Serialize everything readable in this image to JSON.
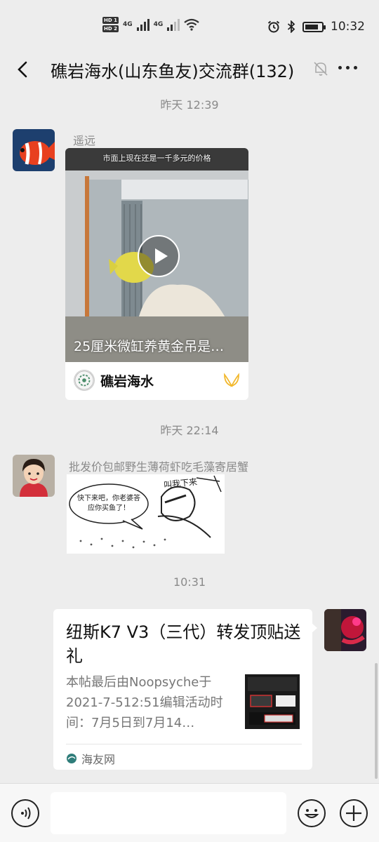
{
  "status_bar": {
    "hd1": "HD 1",
    "hd2": "HD 2",
    "net1": "4G",
    "net2": "4G",
    "time": "10:32",
    "icons": [
      "alarm-icon",
      "bluetooth-icon",
      "battery-icon",
      "wifi-icon"
    ],
    "battery_level": 0.8
  },
  "header": {
    "title": "礁岩海水(山东鱼友)交流群(132)"
  },
  "messages": [
    {
      "timestamp": "昨天 12:39",
      "sender": "遥远",
      "video": {
        "caption": "市面上现在还是一千多元的价格",
        "title": "25厘米微缸养黄金吊是…",
        "channel": "礁岩海水"
      }
    },
    {
      "timestamp": "昨天 22:14",
      "sender": "批发价包邮野生薄荷虾吃毛藻寄居蟹",
      "sticker": {
        "speech": "快下来吧，你老婆答应你买鱼了！",
        "caption": "叫我下来"
      }
    },
    {
      "timestamp": "10:31",
      "link": {
        "title": "纽斯K7 V3（三代）转发顶贴送礼",
        "description": "本帖最后由Noopsyche于2021-7-512:51编辑活动时间：7月5日到7月14…",
        "source": "海友网"
      }
    }
  ],
  "input_bar": {
    "placeholder": ""
  }
}
